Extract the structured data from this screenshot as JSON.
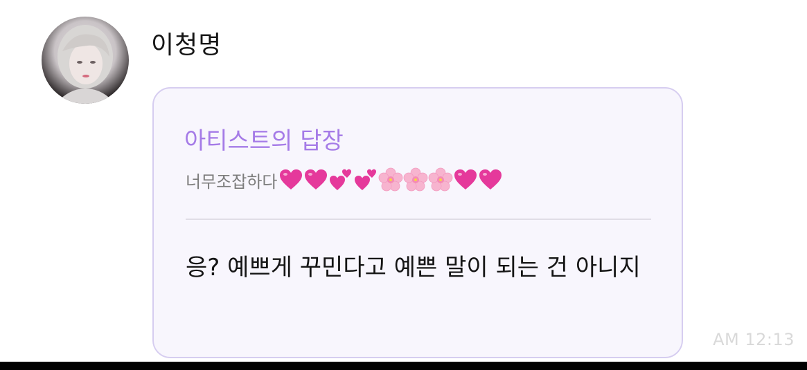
{
  "chat": {
    "sender_name": "이청명",
    "reply_title": "아티스트의 답장",
    "quoted_message": "너무조잡하다",
    "quoted_emojis": [
      "heart-icon",
      "heart-icon",
      "two-hearts-icon",
      "two-hearts-icon",
      "cherry-blossom-icon",
      "cherry-blossom-icon",
      "cherry-blossom-icon",
      "heart-icon",
      "heart-icon"
    ],
    "message": "응? 예쁘게 꾸민다고 예쁜 말이 되는 건 아니지",
    "timestamp": "AM 12:13"
  },
  "colors": {
    "bubble_border": "#d6cdf0",
    "bubble_bg": "#f8f6fd",
    "reply_title": "#a57be7",
    "heart": "#e5399b",
    "blossom": "#f7b4cf"
  }
}
